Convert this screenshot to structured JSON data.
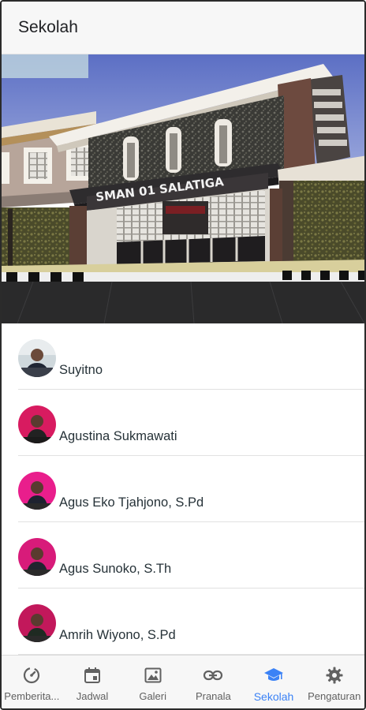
{
  "appbar": {
    "title": "Sekolah"
  },
  "hero": {
    "sign_text": "SMAN 01 SALATIGA"
  },
  "people": [
    {
      "name": "Suyitno",
      "avatar_bg": "#cfd8dc"
    },
    {
      "name": "Agustina Sukmawati",
      "avatar_bg": "#d81b60"
    },
    {
      "name": "Agus Eko Tjahjono, S.Pd",
      "avatar_bg": "#e91e8c"
    },
    {
      "name": "Agus Sunoko, S.Th",
      "avatar_bg": "#d81b7a"
    },
    {
      "name": "Amrih Wiyono, S.Pd",
      "avatar_bg": "#c2185b"
    }
  ],
  "nav": {
    "items": [
      {
        "label": "Pemberita...",
        "icon": "compass-icon"
      },
      {
        "label": "Jadwal",
        "icon": "calendar-icon"
      },
      {
        "label": "Galeri",
        "icon": "image-icon"
      },
      {
        "label": "Pranala",
        "icon": "link-icon"
      },
      {
        "label": "Sekolah",
        "icon": "school-icon",
        "active": true
      },
      {
        "label": "Pengaturan",
        "icon": "gear-icon"
      }
    ]
  },
  "colors": {
    "accent": "#3b82f6",
    "icon_inactive": "#616161",
    "text": "#263238"
  }
}
